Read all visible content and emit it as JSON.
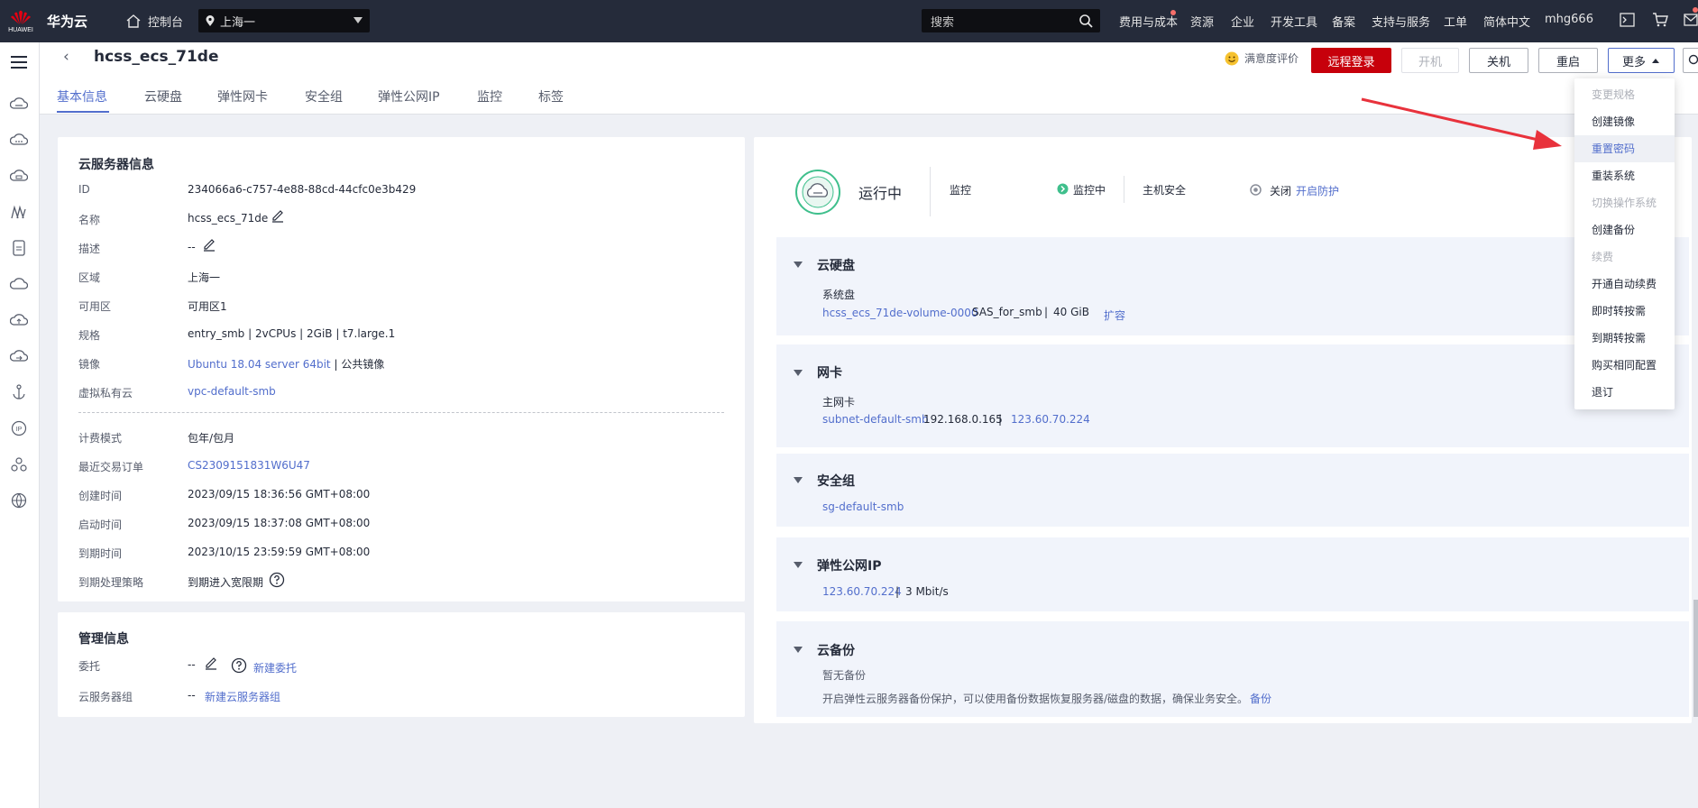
{
  "topbar": {
    "logo_text": "HUAWEI",
    "brand": "华为云",
    "console": "控制台",
    "region": "上海一",
    "search_placeholder": "搜索",
    "nav": [
      "费用与成本",
      "资源",
      "企业",
      "开发工具",
      "备案",
      "支持与服务",
      "工单",
      "简体中文",
      "mhg666"
    ]
  },
  "header": {
    "title": "hcss_ecs_71de",
    "satisfaction": "满意度评价",
    "buttons": {
      "remote": "远程登录",
      "start": "开机",
      "stop": "关机",
      "restart": "重启",
      "more": "更多"
    },
    "tabs": [
      "基本信息",
      "云硬盘",
      "弹性网卡",
      "安全组",
      "弹性公网IP",
      "监控",
      "标签"
    ]
  },
  "server_info": {
    "title": "云服务器信息",
    "rows": [
      {
        "label": "ID",
        "value": "234066a6-c757-4e88-88cd-44cfc0e3b429"
      },
      {
        "label": "名称",
        "value": "hcss_ecs_71de"
      },
      {
        "label": "描述",
        "value": "--"
      },
      {
        "label": "区域",
        "value": "上海一"
      },
      {
        "label": "可用区",
        "value": "可用区1"
      },
      {
        "label": "规格",
        "value": "entry_smb | 2vCPUs | 2GiB | t7.large.1"
      },
      {
        "label": "镜像",
        "value": "Ubuntu 18.04 server 64bit",
        "suffix": " | 公共镜像"
      },
      {
        "label": "虚拟私有云",
        "value": "vpc-default-smb"
      }
    ],
    "billing_rows": [
      {
        "label": "计费模式",
        "value": "包年/包月"
      },
      {
        "label": "最近交易订单",
        "value": "CS2309151831W6U47"
      },
      {
        "label": "创建时间",
        "value": "2023/09/15 18:36:56 GMT+08:00"
      },
      {
        "label": "启动时间",
        "value": "2023/09/15 18:37:08 GMT+08:00"
      },
      {
        "label": "到期时间",
        "value": "2023/10/15 23:59:59 GMT+08:00"
      },
      {
        "label": "到期处理策略",
        "value": "到期进入宽限期"
      }
    ]
  },
  "mgmt_info": {
    "title": "管理信息",
    "delegate_label": "委托",
    "delegate_value": "--",
    "delegate_link": "新建委托",
    "group_label": "云服务器组",
    "group_value": "--",
    "group_link": "新建云服务器组"
  },
  "status": {
    "state": "运行中",
    "monitor_label": "监控",
    "monitor_value": "监控中",
    "host_sec_label": "主机安全",
    "host_sec_value": "关闭",
    "host_sec_link": "开启防护"
  },
  "disk": {
    "title": "云硬盘",
    "sub": "系统盘",
    "name": "hcss_ecs_71de-volume-0000",
    "type": "SAS_for_smb",
    "size": "40 GiB",
    "expand": "扩容"
  },
  "nic": {
    "title": "网卡",
    "sub": "主网卡",
    "subnet": "subnet-default-smb",
    "private_ip": "192.168.0.165",
    "public_ip": "123.60.70.224"
  },
  "secgroup": {
    "title": "安全组",
    "name": "sg-default-smb"
  },
  "eip": {
    "title": "弹性公网IP",
    "ip": "123.60.70.224",
    "bandwidth": "3 Mbit/s"
  },
  "backup": {
    "title": "云备份",
    "none": "暂无备份",
    "desc": "开启弹性云服务器备份保护，可以使用备份数据恢复服务器/磁盘的数据，确保业务安全。",
    "link": "备份"
  },
  "more_menu": [
    {
      "label": "变更规格",
      "disabled": true
    },
    {
      "label": "创建镜像",
      "disabled": false
    },
    {
      "label": "重置密码",
      "disabled": false,
      "highlight": true
    },
    {
      "label": "重装系统",
      "disabled": false
    },
    {
      "label": "切换操作系统",
      "disabled": true
    },
    {
      "label": "创建备份",
      "disabled": false
    },
    {
      "label": "续费",
      "disabled": true
    },
    {
      "label": "开通自动续费",
      "disabled": false
    },
    {
      "label": "即时转按需",
      "disabled": false
    },
    {
      "label": "到期转按需",
      "disabled": false
    },
    {
      "label": "购买相同配置",
      "disabled": false
    },
    {
      "label": "退订",
      "disabled": false
    }
  ],
  "colors": {
    "accent": "#526ecc",
    "primary_red": "#c7000b",
    "topbar": "#252b3a",
    "arrow": "#e8323c",
    "status_green": "#3fbf8c"
  }
}
